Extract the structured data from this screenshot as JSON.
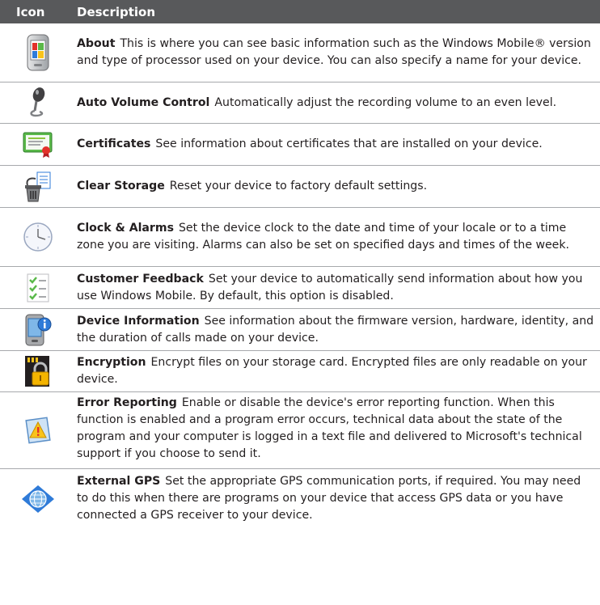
{
  "header": {
    "icon_col": "Icon",
    "desc_col": "Description"
  },
  "rows": [
    {
      "icon": "about-icon",
      "name": "About",
      "description": "This is where you can see basic information such as the Windows Mobile® version and type of processor used on your device. You can also specify a name for your device."
    },
    {
      "icon": "microphone-icon",
      "name": "Auto Volume Control",
      "description": "Automatically adjust the recording volume to an even level."
    },
    {
      "icon": "certificate-icon",
      "name": "Certificates",
      "description": "See information about certificates that are installed on your device."
    },
    {
      "icon": "clear-storage-icon",
      "name": "Clear Storage",
      "description": "Reset your device to factory default settings."
    },
    {
      "icon": "clock-icon",
      "name": "Clock & Alarms",
      "description": "Set the device clock to the date and time of your locale or to a time zone you are visiting. Alarms can also be set on specified days and times of the week."
    },
    {
      "icon": "checklist-icon",
      "name": "Customer Feedback",
      "description": "Set your device to automatically send information about how you use Windows Mobile. By default, this option is disabled."
    },
    {
      "icon": "device-info-icon",
      "name": "Device Information",
      "description": "See information about the firmware version, hardware, identity, and the duration of calls made on your device."
    },
    {
      "icon": "padlock-card-icon",
      "name": "Encryption",
      "description": "Encrypt files on your storage card. Encrypted files are only readable on your device."
    },
    {
      "icon": "warning-window-icon",
      "name": "Error Reporting",
      "description": "Enable or disable the device's error reporting function. When this function is enabled and a program error occurs, technical data about the state of the program and your computer is logged in a text file and delivered to Microsoft's technical support if you choose to send it."
    },
    {
      "icon": "gps-globe-icon",
      "name": "External GPS",
      "description": "Set the appropriate GPS communication ports, if required. You may need to do this when there are programs on your device that access GPS data or you have connected a GPS receiver to your device."
    }
  ]
}
